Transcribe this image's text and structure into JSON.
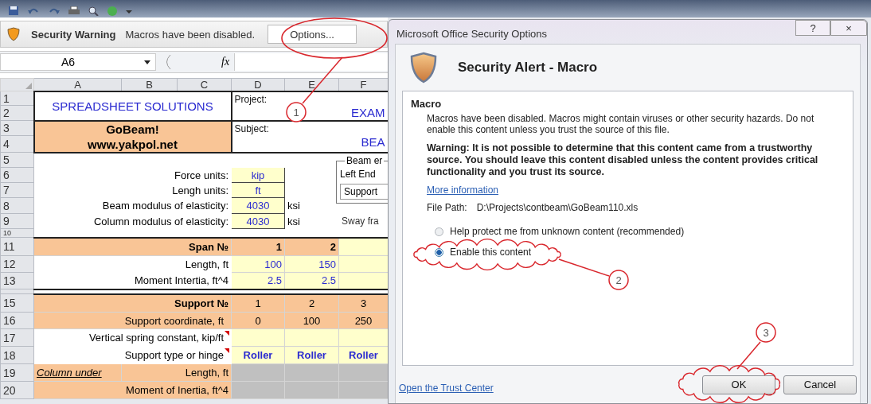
{
  "security_bar": {
    "title": "Security Warning",
    "message": "Macros have been disabled.",
    "button": "Options..."
  },
  "formula_bar": {
    "name_box": "A6",
    "function_label": "fx"
  },
  "sheet": {
    "columns": [
      "A",
      "B",
      "C",
      "D",
      "E",
      "F"
    ],
    "row_numbers": [
      "1",
      "2",
      "3",
      "4",
      "5",
      "6",
      "7",
      "8",
      "9",
      "10",
      "11",
      "12",
      "13",
      "15",
      "16",
      "17",
      "18",
      "19",
      "20"
    ],
    "title_block": {
      "company": "SPREADSHEET SOLUTIONS",
      "program": "GoBeam!",
      "website": "www.yakpol.net",
      "project_label": "Project:",
      "project_value": "EXAM",
      "subject_label": "Subject:",
      "subject_value": "BEA"
    },
    "units": [
      {
        "label": "Force units:",
        "value": "kip"
      },
      {
        "label": "Lengh units:",
        "value": "ft"
      },
      {
        "label": "Beam modulus of elasticity:",
        "value": "4030",
        "unit": "ksi"
      },
      {
        "label": "Column modulus of elasticity:",
        "value": "4030",
        "unit": "ksi"
      }
    ],
    "beam_ends": {
      "legend": "Beam er",
      "left_end_label": "Left End",
      "left_end_value": "Support",
      "sway_label": "Sway fra"
    },
    "spans": {
      "header": "Span №",
      "numbers": [
        "1",
        "2"
      ],
      "rows": [
        {
          "label": "Length, ft",
          "values": [
            "100",
            "150"
          ]
        },
        {
          "label": "Moment Intertia, ft^4",
          "values": [
            "2.5",
            "2.5"
          ]
        }
      ]
    },
    "supports": {
      "header": "Support №",
      "numbers": [
        "1",
        "2",
        "3"
      ],
      "rows": [
        {
          "label": "Support coordinate, ft",
          "kind": "output",
          "comment": false,
          "values": [
            "0",
            "100",
            "250"
          ]
        },
        {
          "label": "Vertical spring constant, kip/ft",
          "kind": "input",
          "comment": true
        },
        {
          "label": "Support type or hinge",
          "kind": "choice",
          "comment": true,
          "values": [
            "Roller",
            "Roller",
            "Roller"
          ]
        }
      ]
    },
    "column_under": {
      "title": "Column under",
      "rows": [
        {
          "label": "Length, ft"
        },
        {
          "label": "Moment of Inertia, ft^4"
        }
      ]
    }
  },
  "dialog": {
    "title": "Microsoft Office Security Options",
    "title_buttons": [
      "?",
      "×"
    ],
    "heading": "Security Alert - Macro",
    "section": "Macro",
    "description": "Macros have been disabled. Macros might contain viruses or other security hazards. Do not enable this content unless you trust the source of this file.",
    "warning": "Warning: It is not possible to determine that this content came from a trustworthy source. You should leave this content disabled unless the content provides critical functionality and you trust its source.",
    "link": "More information",
    "file_path_label": "File Path:",
    "file_path": "D:\\Projects\\contbeam\\GoBeam110.xls",
    "options": [
      {
        "label": "Help protect me from unknown content (recommended)",
        "selected": false
      },
      {
        "label": "Enable this content",
        "selected": true
      }
    ],
    "trust_center_link": "Open the Trust Center",
    "buttons": [
      "OK",
      "Cancel"
    ]
  },
  "annotations": [
    {
      "number": "1"
    },
    {
      "number": "2"
    },
    {
      "number": "3"
    }
  ]
}
